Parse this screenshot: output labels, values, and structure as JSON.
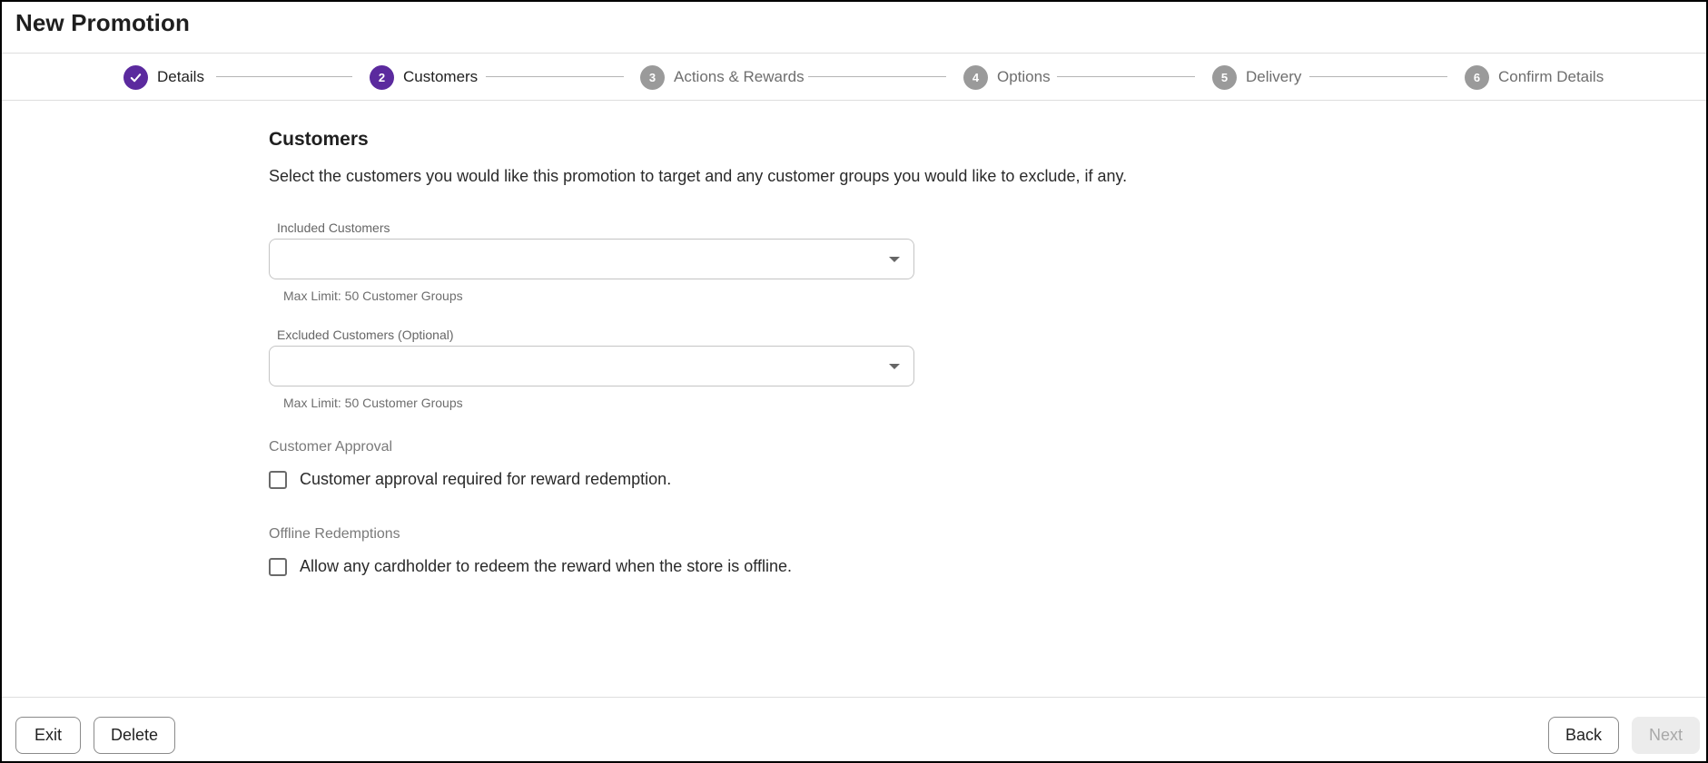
{
  "header": {
    "title": "New Promotion"
  },
  "stepper": {
    "steps": [
      {
        "number": "1",
        "label": "Details",
        "state": "completed",
        "icon": "check-icon"
      },
      {
        "number": "2",
        "label": "Customers",
        "state": "current"
      },
      {
        "number": "3",
        "label": "Actions & Rewards",
        "state": "upcoming"
      },
      {
        "number": "4",
        "label": "Options",
        "state": "upcoming"
      },
      {
        "number": "5",
        "label": "Delivery",
        "state": "upcoming"
      },
      {
        "number": "6",
        "label": "Confirm Details",
        "state": "upcoming"
      }
    ],
    "colors": {
      "active": "#5b2a9e",
      "inactive": "#9a9a9a"
    }
  },
  "main": {
    "title": "Customers",
    "description": "Select the customers you would like this promotion to target and any customer groups you would like to exclude, if any.",
    "included": {
      "label": "Included Customers",
      "value": "",
      "helper": "Max Limit: 50 Customer Groups"
    },
    "excluded": {
      "label": "Excluded Customers (Optional)",
      "value": "",
      "helper": "Max Limit: 50 Customer Groups"
    },
    "approval": {
      "group_label": "Customer Approval",
      "checkbox_label": "Customer approval required for reward redemption.",
      "checked": false
    },
    "offline": {
      "group_label": "Offline Redemptions",
      "checkbox_label": "Allow any cardholder to redeem the reward when the store is offline.",
      "checked": false
    }
  },
  "footer": {
    "exit_label": "Exit",
    "delete_label": "Delete",
    "back_label": "Back",
    "next_label": "Next",
    "next_disabled": true
  }
}
